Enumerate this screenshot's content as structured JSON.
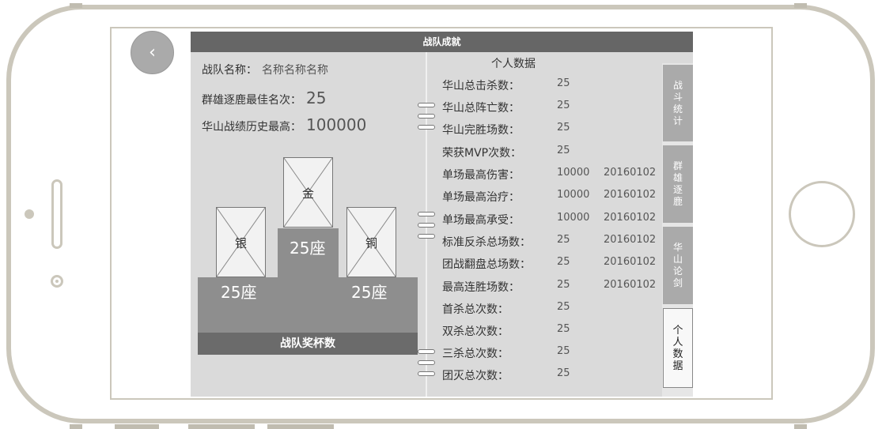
{
  "app": {
    "title": "战队成就",
    "team_name_label": "战队名称：",
    "team_name_value": "名称名称名称",
    "best_rank_label": "群雄逐鹿最佳名次：",
    "best_rank_value": "25",
    "history_label": "华山战绩历史最高：",
    "history_value": "100000"
  },
  "trophies": {
    "gold_label": "金",
    "silver_label": "银",
    "bronze_label": "铜",
    "gold_seats": "25座",
    "silver_seats": "25座",
    "bronze_seats": "25座",
    "footer": "战队奖杯数"
  },
  "personal": {
    "title": "个人数据",
    "rows": [
      {
        "label": "华山总击杀数：",
        "value": "25",
        "date": ""
      },
      {
        "label": "华山总阵亡数：",
        "value": "25",
        "date": ""
      },
      {
        "label": "华山完胜场数：",
        "value": "25",
        "date": ""
      },
      {
        "label": "荣获MVP次数：",
        "value": "25",
        "date": ""
      },
      {
        "label": "单场最高伤害：",
        "value": "10000",
        "date": "20160102"
      },
      {
        "label": "单场最高治疗：",
        "value": "10000",
        "date": "20160102"
      },
      {
        "label": "单场最高承受：",
        "value": "10000",
        "date": "20160102"
      },
      {
        "label": "标准反杀总场数：",
        "value": "25",
        "date": "20160102"
      },
      {
        "label": "团战翻盘总场数：",
        "value": "25",
        "date": "20160102"
      },
      {
        "label": "最高连胜场数：",
        "value": "25",
        "date": "20160102"
      },
      {
        "label": "首杀总次数：",
        "value": "25",
        "date": ""
      },
      {
        "label": "双杀总次数：",
        "value": "25",
        "date": ""
      },
      {
        "label": "三杀总次数：",
        "value": "25",
        "date": ""
      },
      {
        "label": "团灭总次数：",
        "value": "25",
        "date": ""
      }
    ]
  },
  "tabs": [
    {
      "label": "战\n斗\n统\n计"
    },
    {
      "label": "群\n雄\n逐\n鹿"
    },
    {
      "label": "华\n山\n论\n剑"
    },
    {
      "label": "个\n人\n数\n据"
    }
  ],
  "colors": {
    "titlebar": "#666666",
    "panel": "#dadada",
    "tab": "#aaaaaa",
    "podium": "#8e8e8e"
  },
  "icons": {
    "back": "chevron-left-icon"
  }
}
